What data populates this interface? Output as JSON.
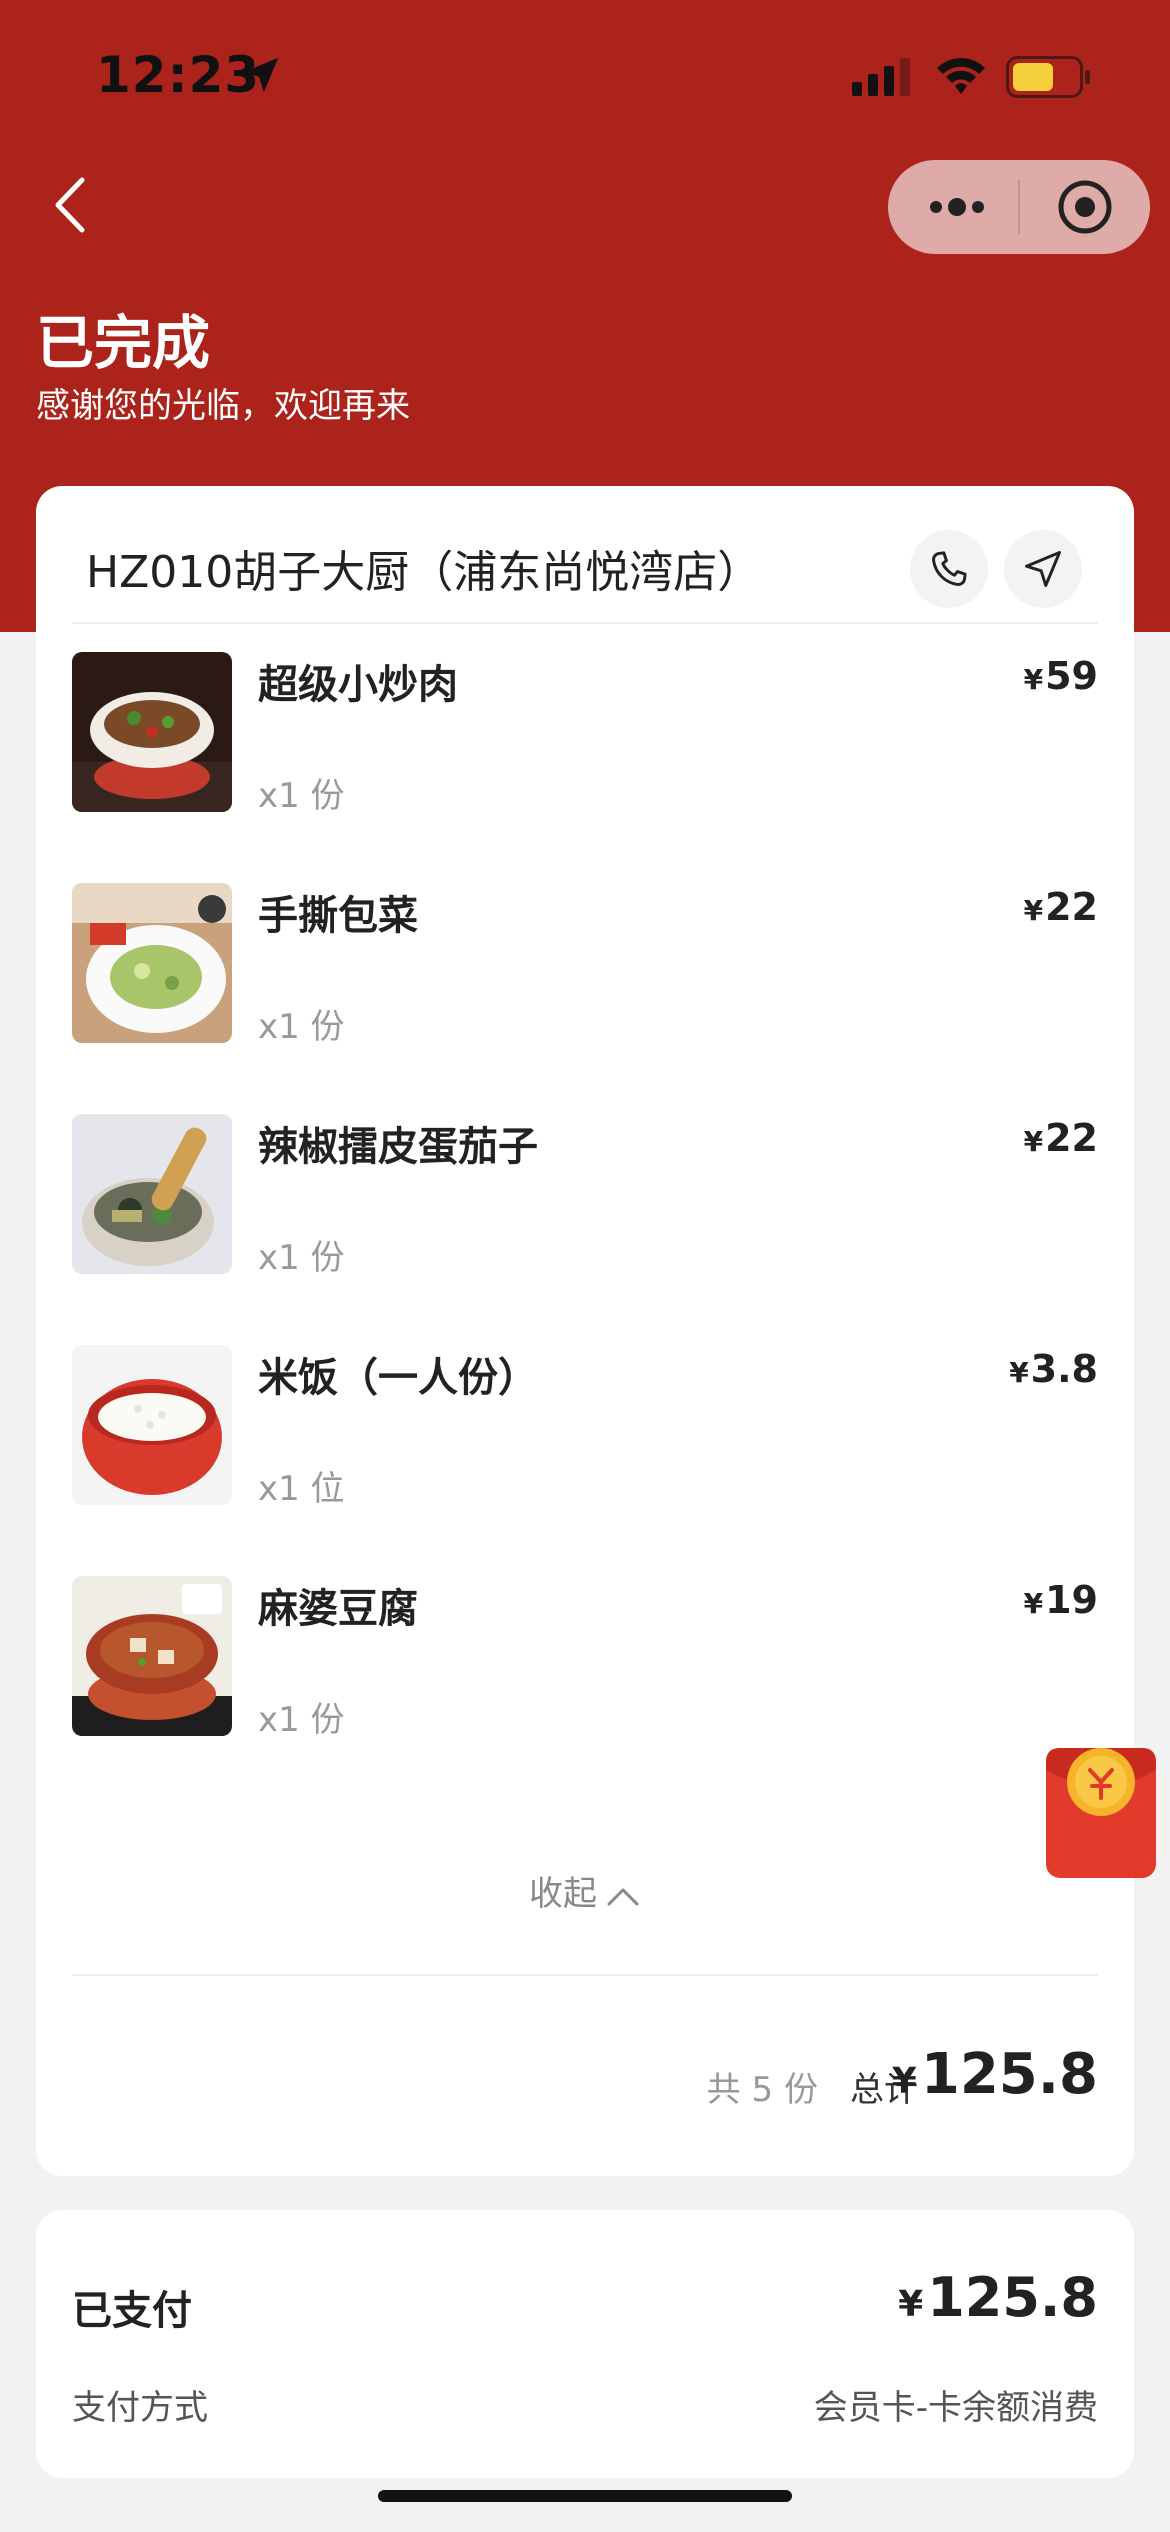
{
  "status_bar": {
    "time": "12:23"
  },
  "header": {
    "title": "已完成",
    "subtitle": "感谢您的光临，欢迎再来"
  },
  "store": {
    "name": "HZ010胡子大厨（浦东尚悦湾店）"
  },
  "items": [
    {
      "name": "超级小炒肉",
      "price": "59",
      "qty": "x1 份"
    },
    {
      "name": "手撕包菜",
      "price": "22",
      "qty": "x1 份"
    },
    {
      "name": "辣椒擂皮蛋茄子",
      "price": "22",
      "qty": "x1 份"
    },
    {
      "name": "米饭（一人份）",
      "price": "3.8",
      "qty": "x1 位"
    },
    {
      "name": "麻婆豆腐",
      "price": "19",
      "qty": "x1 份"
    }
  ],
  "collapse_label": "收起",
  "summary": {
    "count": "共 5 份",
    "total_label": "总计",
    "currency": "¥",
    "total": "125.8"
  },
  "payment": {
    "paid_label": "已支付",
    "paid_amount": "125.8",
    "method_label": "支付方式",
    "method_value": "会员卡-卡余额消费"
  },
  "colors": {
    "header_red": "#ac231c",
    "capsule": "#e8a8a4"
  }
}
